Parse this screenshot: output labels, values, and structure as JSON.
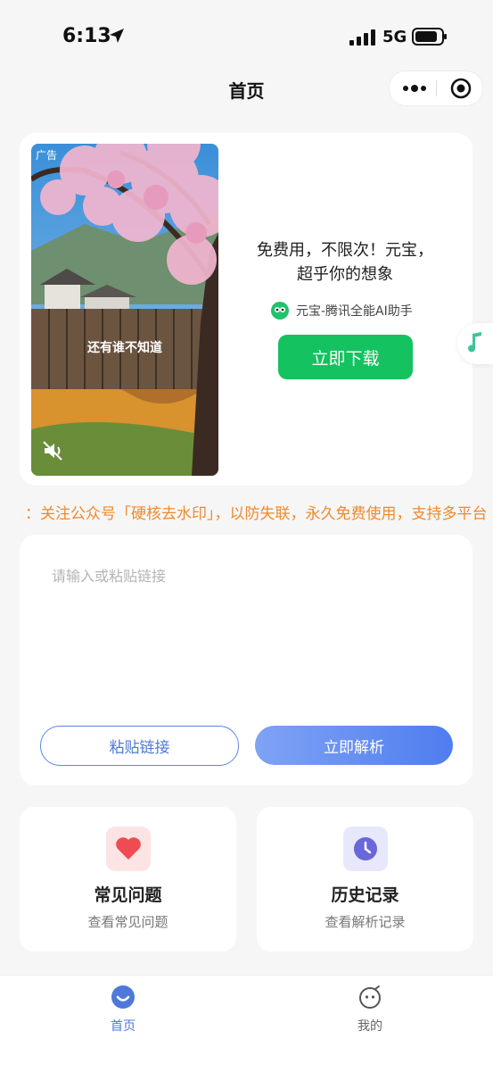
{
  "status_bar": {
    "time": "6:13",
    "network": "5G"
  },
  "nav": {
    "title": "首页"
  },
  "ad": {
    "tag": "广告",
    "video_caption": "还有谁不知道",
    "title_line1": "免费用，不限次！元宝，",
    "title_line2": "超乎你的想象",
    "app_name": "元宝-腾讯全能AI助手",
    "download_label": "立即下载"
  },
  "notice": {
    "text": "：关注公众号「硬核去水印」，以防失联，永久免费使用，支持多平台"
  },
  "link_box": {
    "placeholder": "请输入或粘贴链接",
    "paste_label": "粘贴链接",
    "parse_label": "立即解析"
  },
  "features": [
    {
      "title": "常见问题",
      "subtitle": "查看常见问题"
    },
    {
      "title": "历史记录",
      "subtitle": "查看解析记录"
    }
  ],
  "tabs": [
    {
      "label": "首页"
    },
    {
      "label": "我的"
    }
  ],
  "colors": {
    "accent": "#4f78db",
    "download": "#14c260",
    "notice": "#ef8a2a"
  }
}
